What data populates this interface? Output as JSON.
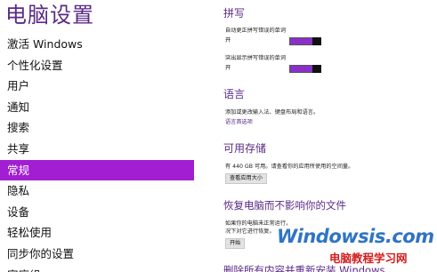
{
  "nav": {
    "title": "电脑设置",
    "items": [
      {
        "label": "激活 Windows",
        "selected": false
      },
      {
        "label": "个性化设置",
        "selected": false
      },
      {
        "label": "用户",
        "selected": false
      },
      {
        "label": "通知",
        "selected": false
      },
      {
        "label": "搜索",
        "selected": false
      },
      {
        "label": "共享",
        "selected": false
      },
      {
        "label": "常规",
        "selected": true
      },
      {
        "label": "隐私",
        "selected": false
      },
      {
        "label": "设备",
        "selected": false
      },
      {
        "label": "轻松使用",
        "selected": false
      },
      {
        "label": "同步你的设置",
        "selected": false
      },
      {
        "label": "家庭组",
        "selected": false
      }
    ]
  },
  "spelling": {
    "title": "拼写",
    "autocorrect_label": "自动更正拼写错误的单词",
    "autocorrect_state": "开",
    "highlight_label": "突出显示拼写错误的单词",
    "highlight_state": "开"
  },
  "language": {
    "title": "语言",
    "description": "添加或更改输入法、键盘布局和语言。",
    "link": "语言首选项"
  },
  "storage": {
    "title": "可用存储",
    "description": "有 440 GB 可用。请查看你的应用所使用的空间量。",
    "button": "查看应用大小"
  },
  "refresh": {
    "title": "恢复电脑而不影响你的文件",
    "description_line1": "如果你的电脑未正常运行，",
    "description_line2": "况下对它进行恢复。",
    "button": "开始"
  },
  "reinstall": {
    "title": "删除所有内容并重新安装 Windows"
  },
  "watermark": {
    "site": "Windowsis.com",
    "cn": "电脑教程学习网"
  },
  "colors": {
    "accent": "#a21ed2",
    "title_purple": "#5b2a86",
    "toggle_on": "#8b2fc9"
  }
}
